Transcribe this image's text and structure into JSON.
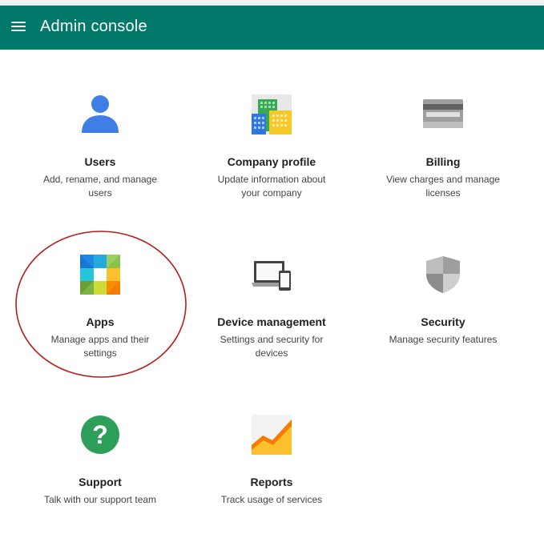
{
  "header": {
    "title": "Admin console",
    "menu_icon": "hamburger-menu-icon",
    "color": "#00796b"
  },
  "tiles": [
    {
      "title": "Users",
      "description": "Add, rename, and manage users",
      "icon": "users-icon"
    },
    {
      "title": "Company profile",
      "description": "Update information about your company",
      "icon": "company-profile-icon"
    },
    {
      "title": "Billing",
      "description": "View charges and manage licenses",
      "icon": "billing-icon"
    },
    {
      "title": "Apps",
      "description": "Manage apps and their settings",
      "icon": "apps-icon"
    },
    {
      "title": "Device management",
      "description": "Settings and security for devices",
      "icon": "device-management-icon"
    },
    {
      "title": "Security",
      "description": "Manage security features",
      "icon": "security-icon"
    },
    {
      "title": "Support",
      "description": "Talk with our support team",
      "icon": "support-icon"
    },
    {
      "title": "Reports",
      "description": "Track usage of services",
      "icon": "reports-icon"
    }
  ],
  "annotation": {
    "shape": "ellipse",
    "color": "#b71c1c",
    "highlighted_tile": "Apps"
  }
}
